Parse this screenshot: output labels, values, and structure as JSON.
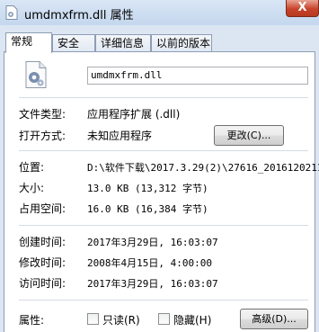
{
  "window": {
    "title": "umdmxfrm.dll 属性",
    "close_label": "X"
  },
  "tabs": [
    {
      "label": "常规"
    },
    {
      "label": "安全"
    },
    {
      "label": "详细信息"
    },
    {
      "label": "以前的版本"
    }
  ],
  "general": {
    "filename": "umdmxfrm.dll",
    "file_type_label": "文件类型:",
    "file_type_value": "应用程序扩展 (.dll)",
    "opens_with_label": "打开方式:",
    "opens_with_value": "未知应用程序",
    "change_button": "更改(C)...",
    "location_label": "位置:",
    "location_value": "D:\\软件下载\\2017.3.29(2)\\27616_2016120211",
    "size_label": "大小:",
    "size_value": "13.0 KB (13,312 字节)",
    "size_on_disk_label": "占用空间:",
    "size_on_disk_value": "16.0 KB (16,384 字节)",
    "created_label": "创建时间:",
    "created_value": "2017年3月29日, 16:03:07",
    "modified_label": "修改时间:",
    "modified_value": "2008年4月15日, 4:00:00",
    "accessed_label": "访问时间:",
    "accessed_value": "2017年3月29日, 16:03:07",
    "attributes_label": "属性:",
    "readonly_label": "只读(R)",
    "hidden_label": "隐藏(H)",
    "advanced_button": "高级(D)...",
    "readonly_checked": false,
    "hidden_checked": false
  },
  "icons": {
    "title_icon": "dll-file-icon",
    "file_icon": "dll-gear-file-icon"
  }
}
